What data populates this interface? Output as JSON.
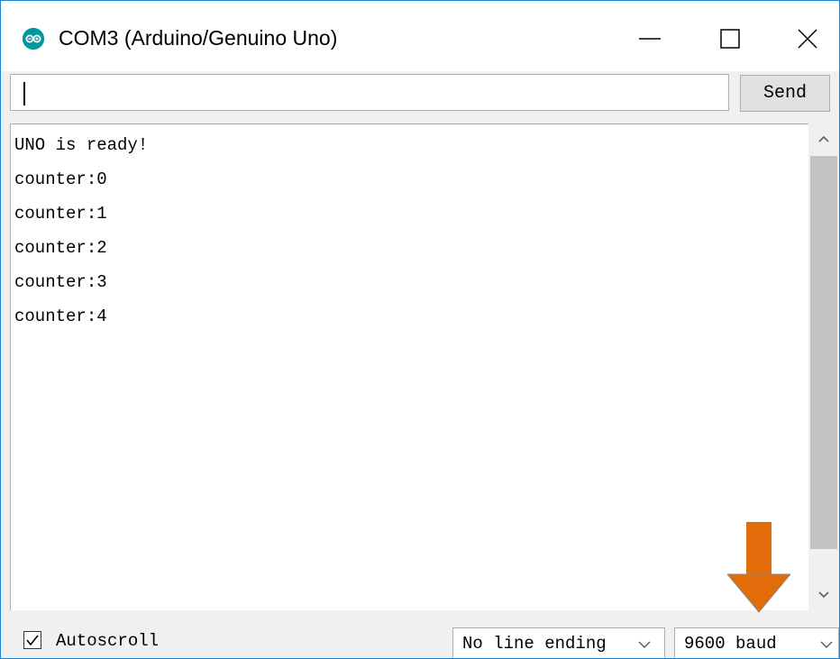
{
  "window": {
    "title": "COM3 (Arduino/Genuino Uno)",
    "icon": "arduino-logo-icon",
    "controls": [
      "minimize-icon",
      "maximize-icon",
      "close-icon"
    ]
  },
  "send": {
    "input_value": "",
    "button_label": "Send"
  },
  "output": {
    "lines": [
      "UNO is ready!",
      "counter:0",
      "counter:1",
      "counter:2",
      "counter:3",
      "counter:4"
    ]
  },
  "bottom": {
    "autoscroll_label": "Autoscroll",
    "autoscroll_checked": true,
    "line_ending": "No line ending",
    "baud_rate": "9600 baud"
  },
  "annotation": {
    "arrow_color": "#e36c0a"
  },
  "colors": {
    "window_border": "#1883d7",
    "arduino_teal": "#00979d"
  }
}
